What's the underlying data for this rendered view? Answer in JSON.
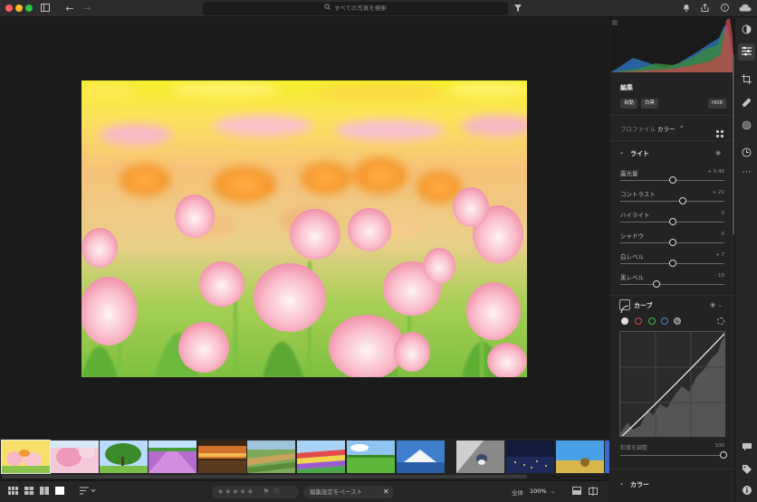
{
  "titlebar": {
    "search_placeholder": "すべての写真を検索"
  },
  "icons": {
    "sidebar_toggle": "sidebar-icon",
    "back": "arrow-left-icon",
    "forward": "arrow-right-icon",
    "filter": "filter-icon",
    "bell": "bell-icon",
    "share": "share-icon",
    "help": "help-icon",
    "cloud": "cloud-icon"
  },
  "edit_panel": {
    "title": "編集",
    "buttons": {
      "auto": "自動",
      "bw": "白黒",
      "hdr": "HDR"
    },
    "profile_label": "プロファイル",
    "profile_value": "カラー",
    "light_section": "ライト",
    "sliders": [
      {
        "label": "露光量",
        "value": "+ 0.40",
        "level": 0.5
      },
      {
        "label": "コントラスト",
        "value": "+ 21",
        "level": 0.6
      },
      {
        "label": "ハイライト",
        "value": "0",
        "level": 0.5
      },
      {
        "label": "シャドウ",
        "value": "0",
        "level": 0.5
      },
      {
        "label": "白レベル",
        "value": "+ 7",
        "level": 0.5
      },
      {
        "label": "黒レベル",
        "value": "- 10",
        "level": 0.35
      }
    ],
    "curve_section": "カーブ",
    "saturation_label": "彩度を調整",
    "saturation_value": "100",
    "color_section": "カラー"
  },
  "bottombar": {
    "paste_label": "編集設定をペースト",
    "fit_label": "全体",
    "zoom_value": "100%"
  }
}
